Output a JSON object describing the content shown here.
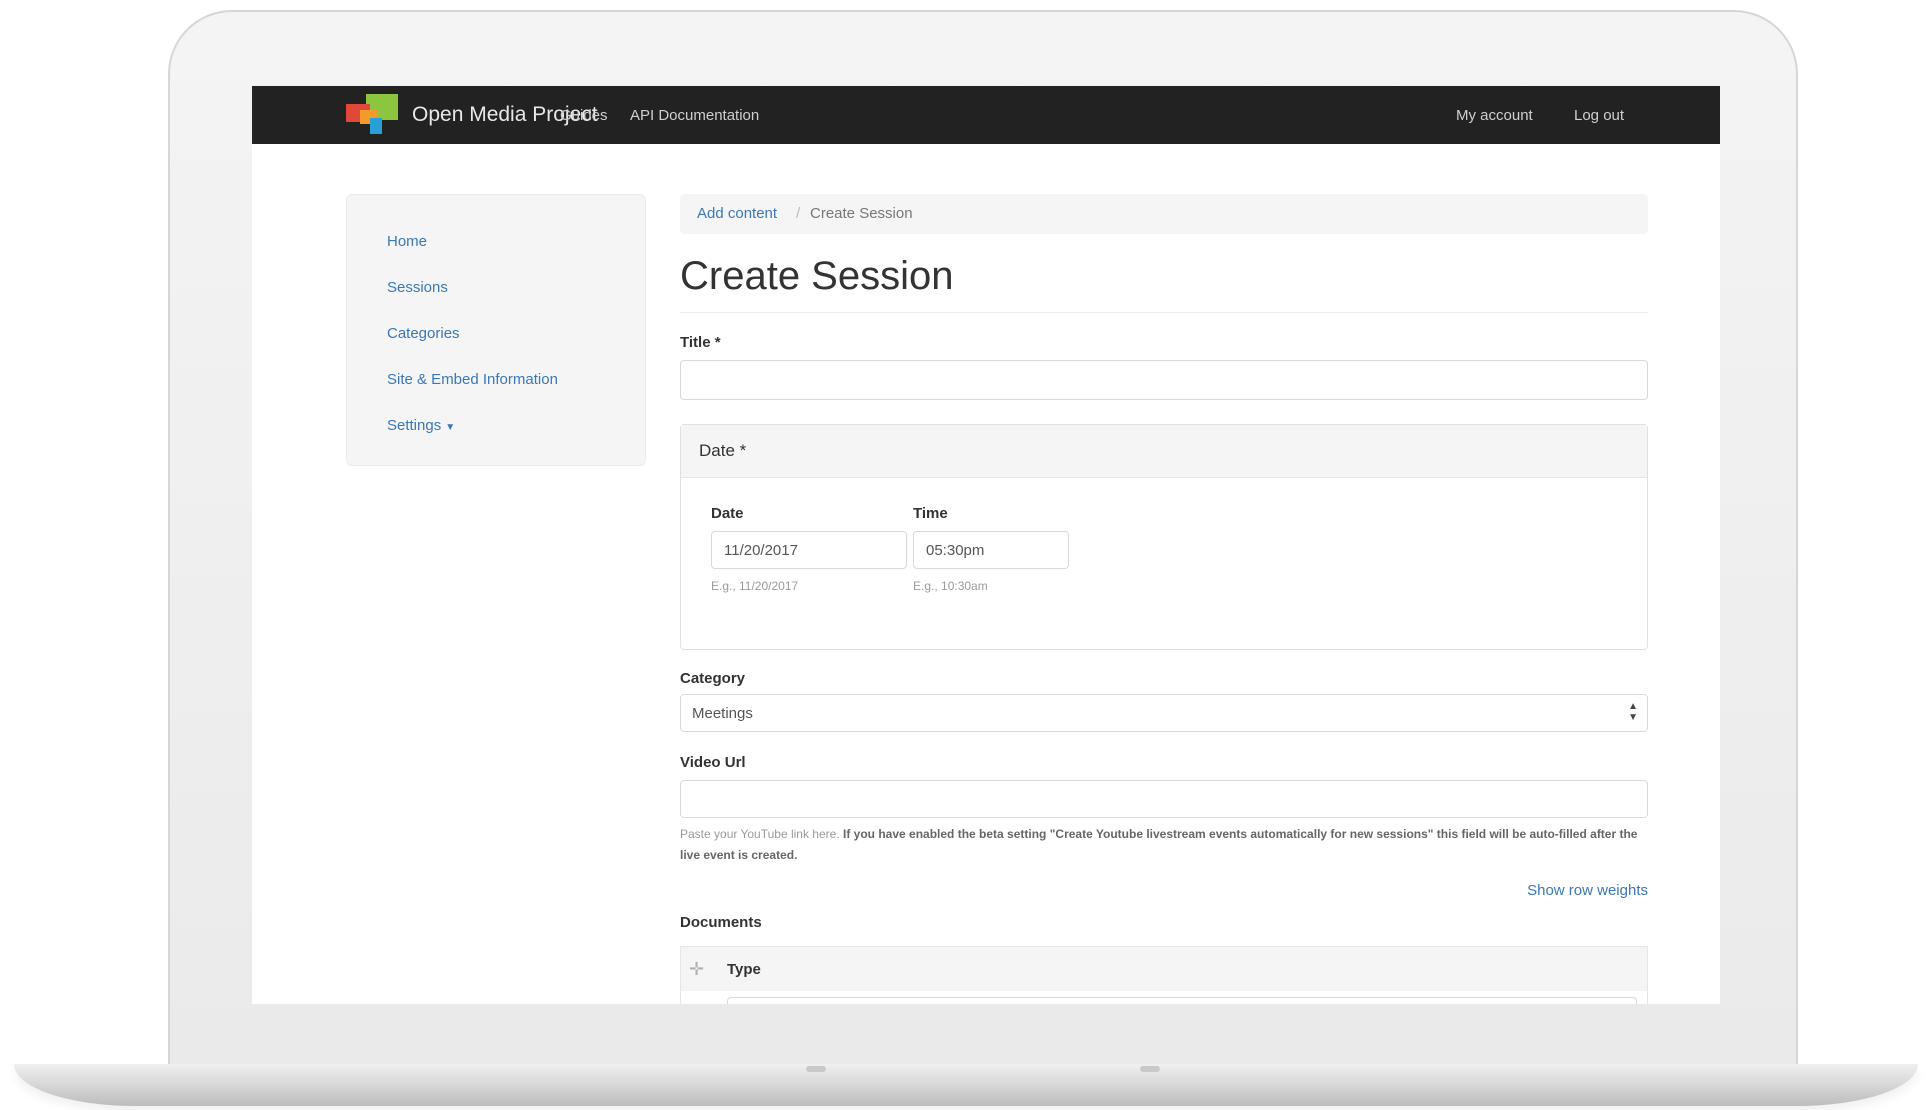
{
  "navbar": {
    "brand": "Open Media Project",
    "links": [
      "Guides",
      "API Documentation"
    ],
    "account": "My account",
    "logout": "Log out"
  },
  "sidebar": {
    "items": [
      {
        "label": "Home"
      },
      {
        "label": "Sessions"
      },
      {
        "label": "Categories"
      },
      {
        "label": "Site & Embed Information"
      },
      {
        "label": "Settings"
      }
    ]
  },
  "breadcrumb": {
    "link": "Add content",
    "separator": "/",
    "current": "Create Session"
  },
  "page": {
    "title": "Create Session"
  },
  "form": {
    "title_label": "Title *",
    "title_value": "",
    "date_section": "Date *",
    "date_label": "Date",
    "date_value": "11/20/2017",
    "date_help": "E.g., 11/20/2017",
    "time_label": "Time",
    "time_value": "05:30pm",
    "time_help": "E.g., 10:30am",
    "category_label": "Category",
    "category_value": "Meetings",
    "video_label": "Video Url",
    "video_value": "",
    "video_help_plain": "Paste your YouTube link here.",
    "video_help_bold": "If you have enabled the beta setting \"Create Youtube livestream events automatically for new sessions\" this field will be auto-filled after the live event is created.",
    "row_weights": "Show row weights",
    "documents_label": "Documents",
    "type_header": "Type"
  },
  "colors": {
    "navbar_bg": "#222222",
    "link": "#3b77b7",
    "logo_red": "#e0483a",
    "logo_orange": "#f29b2b",
    "logo_green": "#8cc63f",
    "logo_blue": "#2a9fd6"
  },
  "icons": {
    "drag": "drag-cross-icon",
    "select_arrows": "up-down-arrows-icon",
    "settings_caret": "caret-down-icon"
  }
}
